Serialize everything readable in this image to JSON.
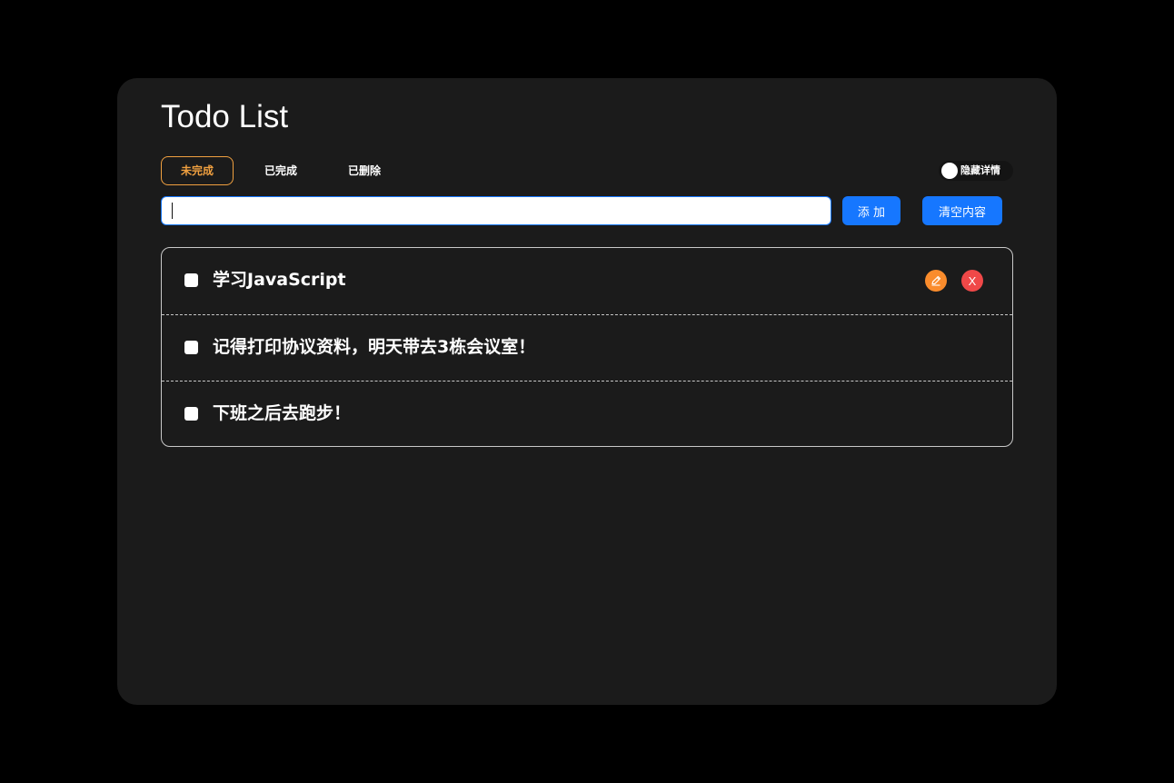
{
  "title": "Todo List",
  "tabs": [
    {
      "label": "未完成",
      "active": true
    },
    {
      "label": "已完成",
      "active": false
    },
    {
      "label": "已删除",
      "active": false
    }
  ],
  "toggle": {
    "label": "隐藏详情",
    "on": false
  },
  "input": {
    "value": "",
    "placeholder": ""
  },
  "buttons": {
    "add": "添 加",
    "clear": "清空内容"
  },
  "todos": [
    {
      "text": "学习JavaScript",
      "checked": false,
      "show_actions": true
    },
    {
      "text": "记得打印协议资料，明天带去3栋会议室！",
      "checked": false,
      "show_actions": false
    },
    {
      "text": "下班之后去跑步！",
      "checked": false,
      "show_actions": false
    }
  ],
  "actions": {
    "edit_icon": "pencil-icon",
    "delete_glyph": "X"
  },
  "colors": {
    "page_bg": "#000000",
    "card_bg": "#1b1b1b",
    "accent": "#1677ff",
    "active_tab": "#f0a040",
    "edit": "#fa8c2c",
    "delete": "#f04848"
  }
}
